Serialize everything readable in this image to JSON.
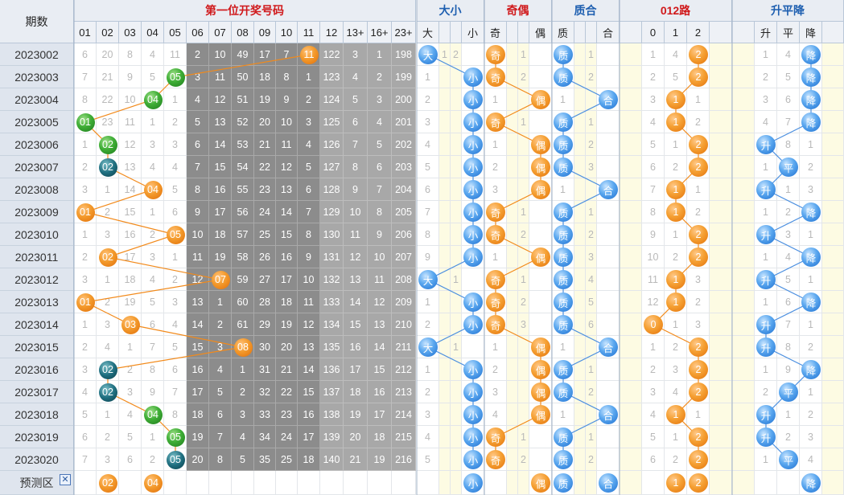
{
  "header": {
    "period_label": "期数",
    "group_first": "第一位开奖号码",
    "group_bigsmall": "大小",
    "group_oddeven": "奇偶",
    "group_primecomposite": "质合",
    "group_012": "012路",
    "group_updown": "升平降"
  },
  "columns": {
    "numbers": [
      "01",
      "02",
      "03",
      "04",
      "05",
      "06",
      "07",
      "08",
      "09",
      "10",
      "11",
      "12",
      "13+",
      "16+",
      "23+"
    ],
    "bigsmall": [
      "大",
      "",
      "",
      "小"
    ],
    "oddeven": [
      "奇",
      "",
      "",
      "偶"
    ],
    "primecomposite": [
      "质",
      "",
      "",
      "合"
    ],
    "road012": [
      "",
      "0",
      "1",
      "2",
      ""
    ],
    "updown": [
      "升",
      "平",
      "降"
    ]
  },
  "rows": [
    {
      "period": "2023002",
      "nums": [
        "6",
        "20",
        "8",
        "4",
        "11",
        "2",
        "10",
        "49",
        "17",
        "7",
        "11",
        "122",
        "3",
        "1",
        "198"
      ],
      "bs": [
        "大",
        "1",
        "2",
        ""
      ],
      "oe": [
        "奇",
        "",
        "1",
        ""
      ],
      "pc": [
        "质",
        "",
        "1",
        ""
      ],
      "r": [
        "",
        "1",
        "4",
        "2",
        ""
      ],
      "ud": [
        "1",
        "4",
        "降"
      ]
    },
    {
      "period": "2023003",
      "nums": [
        "7",
        "21",
        "9",
        "5",
        "05",
        "3",
        "11",
        "50",
        "18",
        "8",
        "1",
        "123",
        "4",
        "2",
        "199"
      ],
      "bs": [
        "1",
        "",
        "",
        "小"
      ],
      "oe": [
        "奇",
        "",
        "2",
        ""
      ],
      "pc": [
        "质",
        "",
        "2",
        ""
      ],
      "r": [
        "",
        "2",
        "5",
        "2",
        ""
      ],
      "ud": [
        "2",
        "5",
        "降"
      ]
    },
    {
      "period": "2023004",
      "nums": [
        "8",
        "22",
        "10",
        "04",
        "1",
        "4",
        "12",
        "51",
        "19",
        "9",
        "2",
        "124",
        "5",
        "3",
        "200"
      ],
      "bs": [
        "2",
        "",
        "",
        "小"
      ],
      "oe": [
        "1",
        "",
        "",
        "偶"
      ],
      "pc": [
        "1",
        "",
        "",
        "合"
      ],
      "r": [
        "",
        "3",
        "1",
        "1",
        ""
      ],
      "ud": [
        "3",
        "6",
        "降"
      ]
    },
    {
      "period": "2023005",
      "nums": [
        "01",
        "23",
        "11",
        "1",
        "2",
        "5",
        "13",
        "52",
        "20",
        "10",
        "3",
        "125",
        "6",
        "4",
        "201"
      ],
      "bs": [
        "3",
        "",
        "",
        "小"
      ],
      "oe": [
        "奇",
        "",
        "1",
        ""
      ],
      "pc": [
        "质",
        "",
        "1",
        ""
      ],
      "r": [
        "",
        "4",
        "1",
        "2",
        ""
      ],
      "ud": [
        "4",
        "7",
        "降"
      ]
    },
    {
      "period": "2023006",
      "nums": [
        "1",
        "02",
        "12",
        "3",
        "3",
        "6",
        "14",
        "53",
        "21",
        "11",
        "4",
        "126",
        "7",
        "5",
        "202"
      ],
      "bs": [
        "4",
        "",
        "",
        "小"
      ],
      "oe": [
        "1",
        "",
        "",
        "偶"
      ],
      "pc": [
        "质",
        "",
        "2",
        ""
      ],
      "r": [
        "",
        "5",
        "1",
        "2",
        ""
      ],
      "ud": [
        "升",
        "8",
        "1"
      ]
    },
    {
      "period": "2023007",
      "nums": [
        "2",
        "02",
        "13",
        "4",
        "4",
        "7",
        "15",
        "54",
        "22",
        "12",
        "5",
        "127",
        "8",
        "6",
        "203"
      ],
      "bs": [
        "5",
        "",
        "",
        "小"
      ],
      "oe": [
        "2",
        "",
        "",
        "偶"
      ],
      "pc": [
        "质",
        "",
        "3",
        ""
      ],
      "r": [
        "",
        "6",
        "2",
        "2",
        ""
      ],
      "ud": [
        "1",
        "平",
        "2"
      ]
    },
    {
      "period": "2023008",
      "nums": [
        "3",
        "1",
        "14",
        "04",
        "5",
        "8",
        "16",
        "55",
        "23",
        "13",
        "6",
        "128",
        "9",
        "7",
        "204"
      ],
      "bs": [
        "6",
        "",
        "",
        "小"
      ],
      "oe": [
        "3",
        "",
        "",
        "偶"
      ],
      "pc": [
        "1",
        "",
        "",
        "合"
      ],
      "r": [
        "",
        "7",
        "1",
        "1",
        ""
      ],
      "ud": [
        "升",
        "1",
        "3"
      ]
    },
    {
      "period": "2023009",
      "nums": [
        "01",
        "2",
        "15",
        "1",
        "6",
        "9",
        "17",
        "56",
        "24",
        "14",
        "7",
        "129",
        "10",
        "8",
        "205"
      ],
      "bs": [
        "7",
        "",
        "",
        "小"
      ],
      "oe": [
        "奇",
        "",
        "1",
        ""
      ],
      "pc": [
        "质",
        "",
        "1",
        ""
      ],
      "r": [
        "",
        "8",
        "1",
        "2",
        ""
      ],
      "ud": [
        "1",
        "2",
        "降"
      ]
    },
    {
      "period": "2023010",
      "nums": [
        "1",
        "3",
        "16",
        "2",
        "05",
        "10",
        "18",
        "57",
        "25",
        "15",
        "8",
        "130",
        "11",
        "9",
        "206"
      ],
      "bs": [
        "8",
        "",
        "",
        "小"
      ],
      "oe": [
        "奇",
        "",
        "2",
        ""
      ],
      "pc": [
        "质",
        "",
        "2",
        ""
      ],
      "r": [
        "",
        "9",
        "1",
        "2",
        ""
      ],
      "ud": [
        "升",
        "3",
        "1"
      ]
    },
    {
      "period": "2023011",
      "nums": [
        "2",
        "02",
        "17",
        "3",
        "1",
        "11",
        "19",
        "58",
        "26",
        "16",
        "9",
        "131",
        "12",
        "10",
        "207"
      ],
      "bs": [
        "9",
        "",
        "",
        "小"
      ],
      "oe": [
        "1",
        "",
        "",
        "偶"
      ],
      "pc": [
        "质",
        "",
        "3",
        ""
      ],
      "r": [
        "",
        "10",
        "2",
        "2",
        ""
      ],
      "ud": [
        "1",
        "4",
        "降"
      ]
    },
    {
      "period": "2023012",
      "nums": [
        "3",
        "1",
        "18",
        "4",
        "2",
        "12",
        "07",
        "59",
        "27",
        "17",
        "10",
        "132",
        "13",
        "11",
        "208"
      ],
      "bs": [
        "大",
        "",
        "1",
        ""
      ],
      "oe": [
        "奇",
        "",
        "1",
        ""
      ],
      "pc": [
        "质",
        "",
        "4",
        ""
      ],
      "r": [
        "",
        "11",
        "1",
        "3",
        ""
      ],
      "ud": [
        "升",
        "5",
        "1"
      ]
    },
    {
      "period": "2023013",
      "nums": [
        "01",
        "2",
        "19",
        "5",
        "3",
        "13",
        "1",
        "60",
        "28",
        "18",
        "11",
        "133",
        "14",
        "12",
        "209"
      ],
      "bs": [
        "1",
        "",
        "",
        "小"
      ],
      "oe": [
        "奇",
        "",
        "2",
        ""
      ],
      "pc": [
        "质",
        "",
        "5",
        ""
      ],
      "r": [
        "",
        "12",
        "1",
        "2",
        ""
      ],
      "ud": [
        "1",
        "6",
        "降"
      ]
    },
    {
      "period": "2023014",
      "nums": [
        "1",
        "3",
        "03",
        "6",
        "4",
        "14",
        "2",
        "61",
        "29",
        "19",
        "12",
        "134",
        "15",
        "13",
        "210"
      ],
      "bs": [
        "2",
        "",
        "",
        "小"
      ],
      "oe": [
        "奇",
        "",
        "3",
        ""
      ],
      "pc": [
        "质",
        "",
        "6",
        ""
      ],
      "r": [
        "",
        "0",
        "1",
        "3",
        ""
      ],
      "ud": [
        "升",
        "7",
        "1"
      ]
    },
    {
      "period": "2023015",
      "nums": [
        "2",
        "4",
        "1",
        "7",
        "5",
        "15",
        "3",
        "08",
        "30",
        "20",
        "13",
        "135",
        "16",
        "14",
        "211"
      ],
      "bs": [
        "大",
        "",
        "1",
        ""
      ],
      "oe": [
        "1",
        "",
        "",
        "偶"
      ],
      "pc": [
        "1",
        "",
        "",
        "合"
      ],
      "r": [
        "",
        "1",
        "2",
        "2",
        ""
      ],
      "ud": [
        "升",
        "8",
        "2"
      ]
    },
    {
      "period": "2023016",
      "nums": [
        "3",
        "02",
        "2",
        "8",
        "6",
        "16",
        "4",
        "1",
        "31",
        "21",
        "14",
        "136",
        "17",
        "15",
        "212"
      ],
      "bs": [
        "1",
        "",
        "",
        "小"
      ],
      "oe": [
        "2",
        "",
        "",
        "偶"
      ],
      "pc": [
        "质",
        "",
        "1",
        ""
      ],
      "r": [
        "",
        "2",
        "3",
        "2",
        ""
      ],
      "ud": [
        "1",
        "9",
        "降"
      ]
    },
    {
      "period": "2023017",
      "nums": [
        "4",
        "02",
        "3",
        "9",
        "7",
        "17",
        "5",
        "2",
        "32",
        "22",
        "15",
        "137",
        "18",
        "16",
        "213"
      ],
      "bs": [
        "2",
        "",
        "",
        "小"
      ],
      "oe": [
        "3",
        "",
        "",
        "偶"
      ],
      "pc": [
        "质",
        "",
        "2",
        ""
      ],
      "r": [
        "",
        "3",
        "4",
        "2",
        ""
      ],
      "ud": [
        "2",
        "平",
        "1"
      ]
    },
    {
      "period": "2023018",
      "nums": [
        "5",
        "1",
        "4",
        "04",
        "8",
        "18",
        "6",
        "3",
        "33",
        "23",
        "16",
        "138",
        "19",
        "17",
        "214"
      ],
      "bs": [
        "3",
        "",
        "",
        "小"
      ],
      "oe": [
        "4",
        "",
        "",
        "偶"
      ],
      "pc": [
        "1",
        "",
        "",
        "合"
      ],
      "r": [
        "",
        "4",
        "1",
        "1",
        ""
      ],
      "ud": [
        "升",
        "1",
        "2"
      ]
    },
    {
      "period": "2023019",
      "nums": [
        "6",
        "2",
        "5",
        "1",
        "05",
        "19",
        "7",
        "4",
        "34",
        "24",
        "17",
        "139",
        "20",
        "18",
        "215"
      ],
      "bs": [
        "4",
        "",
        "",
        "小"
      ],
      "oe": [
        "奇",
        "",
        "1",
        ""
      ],
      "pc": [
        "质",
        "",
        "1",
        ""
      ],
      "r": [
        "",
        "5",
        "1",
        "2",
        ""
      ],
      "ud": [
        "升",
        "2",
        "3"
      ]
    },
    {
      "period": "2023020",
      "nums": [
        "7",
        "3",
        "6",
        "2",
        "05",
        "20",
        "8",
        "5",
        "35",
        "25",
        "18",
        "140",
        "21",
        "19",
        "216"
      ],
      "bs": [
        "5",
        "",
        "",
        "小"
      ],
      "oe": [
        "奇",
        "",
        "2",
        ""
      ],
      "pc": [
        "质",
        "",
        "2",
        ""
      ],
      "r": [
        "",
        "6",
        "2",
        "2",
        ""
      ],
      "ud": [
        "1",
        "平",
        "4"
      ]
    }
  ],
  "predict": {
    "label": "预测区",
    "close_symbol": "✕",
    "nums": [
      "",
      "02",
      "",
      "04",
      "",
      "",
      "",
      "",
      "",
      "",
      "",
      "",
      "",
      "",
      ""
    ],
    "bs": [
      "",
      "",
      "",
      "小"
    ],
    "oe": [
      "",
      "",
      "",
      "偶"
    ],
    "pc": [
      "质",
      "",
      "",
      "合"
    ],
    "r": [
      "",
      "",
      "1",
      "2",
      ""
    ],
    "ud": [
      "",
      "",
      "降"
    ]
  },
  "colors": {
    "orange_ball": "#f39a2c",
    "green_ball": "#3fae36",
    "teal_ball": "#1f6f80",
    "blue_ball": "#5aa7ef",
    "link_orange": "#f28a1b",
    "link_blue": "#4b8fe0",
    "grey_dark": "#8c8c8c"
  }
}
